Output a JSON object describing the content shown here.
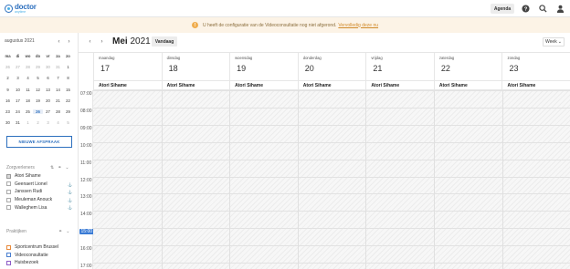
{
  "app": {
    "logo_name": "doctor",
    "logo_sub": "anytime"
  },
  "topbar": {
    "agenda_label": "Agenda",
    "icons": [
      "help-icon",
      "search-icon",
      "user-icon"
    ]
  },
  "banner": {
    "icon": "warning-icon",
    "text": "U heeft de configuratie van de Videoconsultatie nog niet afgerond.",
    "link": "Vervolledig deze nu"
  },
  "minical": {
    "title": "augustus 2021",
    "weekdays": [
      "ma",
      "di",
      "wo",
      "do",
      "vr",
      "za",
      "zo"
    ],
    "weeks": [
      [
        "26",
        "27",
        "28",
        "29",
        "30",
        "31",
        "1"
      ],
      [
        "2",
        "3",
        "4",
        "5",
        "6",
        "7",
        "8"
      ],
      [
        "9",
        "10",
        "11",
        "12",
        "13",
        "14",
        "15"
      ],
      [
        "16",
        "17",
        "18",
        "19",
        "20",
        "21",
        "22"
      ],
      [
        "23",
        "24",
        "25",
        "26",
        "27",
        "28",
        "29"
      ],
      [
        "30",
        "31",
        "1",
        "2",
        "3",
        "4",
        "5"
      ]
    ]
  },
  "new_appointment_label": "NIEUWE AFSPRAAK",
  "caregivers": {
    "heading": "Zorgverleners",
    "items": [
      {
        "label": "Atori Sihame",
        "checked": true
      },
      {
        "label": "Geenaert Lionel",
        "checked": false
      },
      {
        "label": "Janssen Rudi",
        "checked": false
      },
      {
        "label": "Meuleman Anouck",
        "checked": false
      },
      {
        "label": "Walleghem Lisa",
        "checked": false
      }
    ]
  },
  "practices": {
    "heading": "Praktijken",
    "items": [
      {
        "label": "Sportcentrum Brussel",
        "color": "#e8893a"
      },
      {
        "label": "Videoconsultatie",
        "color": "#4a7fd0"
      },
      {
        "label": "Huisbezoek",
        "color": "#8e5cc7"
      }
    ]
  },
  "calendar": {
    "month": "Mei",
    "year": "2021",
    "today_label": "Vandaag",
    "view_label": "Week",
    "days": [
      {
        "name": "maandag",
        "num": "17"
      },
      {
        "name": "dinsdag",
        "num": "18"
      },
      {
        "name": "woensdag",
        "num": "19"
      },
      {
        "name": "donderdag",
        "num": "20"
      },
      {
        "name": "vrijdag",
        "num": "21"
      },
      {
        "name": "zaterdag",
        "num": "22"
      },
      {
        "name": "zondag",
        "num": "23"
      }
    ],
    "provider": "Atori Sihame",
    "hours": [
      "07:00",
      "08:00",
      "09:00",
      "10:00",
      "11:00",
      "12:00",
      "13:00",
      "14:00",
      "15:00",
      "16:00",
      "17:00"
    ],
    "current_hour": "15:00"
  }
}
